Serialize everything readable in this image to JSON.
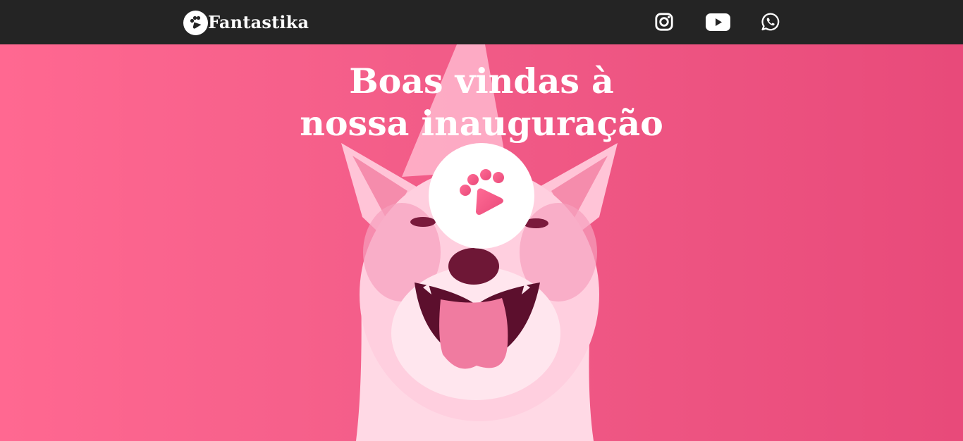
{
  "header": {
    "brand": "Fantastika",
    "logo_icon": "paw-icon",
    "social": [
      {
        "name": "instagram",
        "icon": "instagram-icon"
      },
      {
        "name": "youtube",
        "icon": "youtube-icon"
      },
      {
        "name": "whatsapp",
        "icon": "whatsapp-icon"
      }
    ],
    "background": "#242424"
  },
  "hero": {
    "title_line1": "Boas vindas à",
    "title_line2": "nossa inauguração",
    "play_icon": "paw-play-icon",
    "image": "dog-with-party-hat",
    "accent": "#ec5b87"
  }
}
